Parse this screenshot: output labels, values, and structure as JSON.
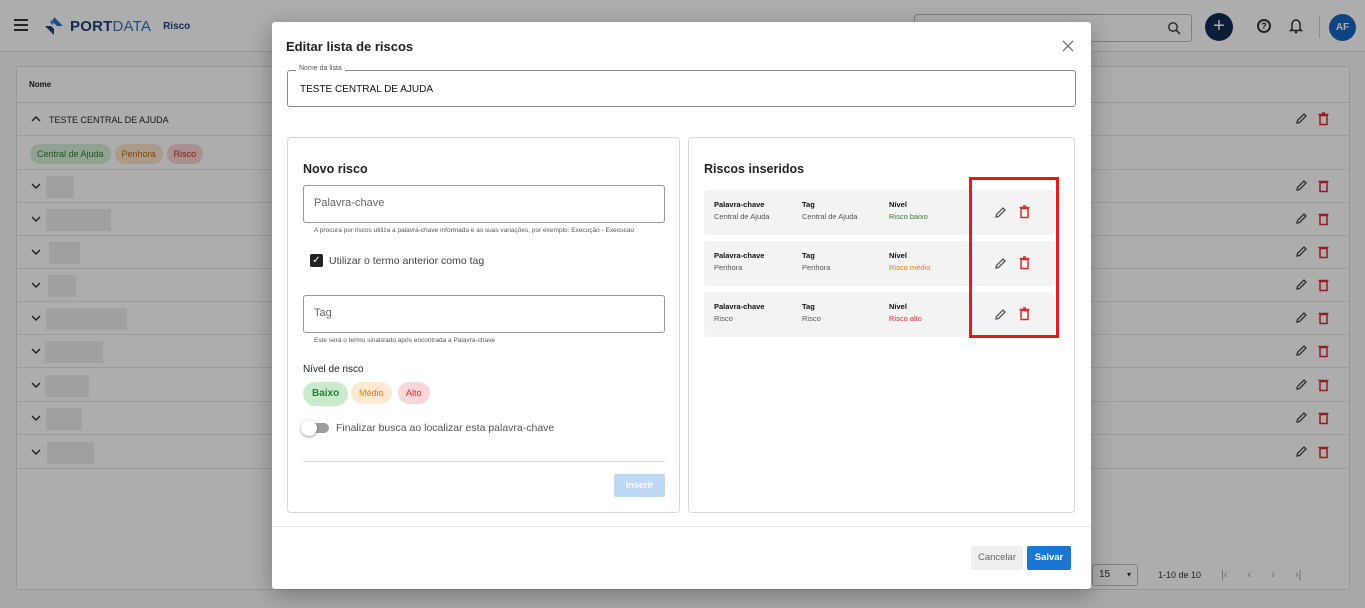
{
  "app": {
    "brand_bold": "PORT",
    "brand_light": "DATA",
    "section": "Risco",
    "avatar_initials": "AF",
    "add_label": "+",
    "help_label": "?"
  },
  "table": {
    "header": "Nome",
    "group_title": "TESTE CENTRAL DE AJUDA",
    "chips": [
      "Central de Ajuda",
      "Penhora",
      "Risco"
    ],
    "pagination": {
      "page_size": "15",
      "range": "1-10 de 10"
    }
  },
  "dialog": {
    "title": "Editar lista de riscos",
    "list_name_label": "Nome da lista",
    "list_name_value": "TESTE CENTRAL DE AJUDA",
    "new_risk": {
      "title": "Novo risco",
      "keyword_placeholder": "Palavra-chave",
      "keyword_hint": "A procura por riscos utiliza a palavra-chave informada e as suas variações, por exemplo: Execução - Execucao",
      "use_as_tag_label": "Utilizar o termo anterior como tag",
      "use_as_tag_checked": true,
      "tag_placeholder": "Tag",
      "tag_hint": "Este será o termo sinalizado após encontrada a Palavra-chave",
      "level_label": "Nível de risco",
      "levels": [
        "Baixo",
        "Médio",
        "Alto"
      ],
      "selected_level": "Baixo",
      "finish_label": "Finalizar busca ao localizar esta palavra-chave",
      "finish_enabled": false,
      "insert_label": "Inserir"
    },
    "inserted": {
      "title": "Riscos inseridos",
      "col_keyword": "Palavra-chave",
      "col_tag": "Tag",
      "col_level": "Nível",
      "items": [
        {
          "keyword": "Central de Ajuda",
          "tag": "Central de Ajuda",
          "level": "Risco baixo",
          "level_color": "#2e7d32"
        },
        {
          "keyword": "Penhora",
          "tag": "Penhora",
          "level": "Risco médio",
          "level_color": "#e08300"
        },
        {
          "keyword": "Risco",
          "tag": "Risco",
          "level": "Risco alto",
          "level_color": "#d32f2f"
        }
      ]
    },
    "cancel_label": "Cancelar",
    "save_label": "Salvar"
  },
  "colors": {
    "primary": "#1976d2",
    "highlight": "#e41b1b",
    "delete": "#d32f2f"
  }
}
